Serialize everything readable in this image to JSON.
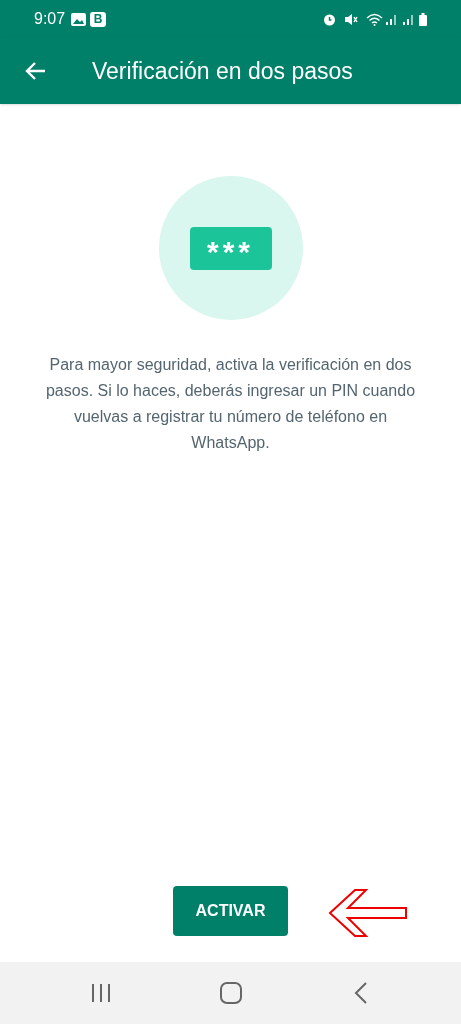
{
  "status_bar": {
    "time": "9:07",
    "app_badge": "B"
  },
  "app_bar": {
    "title": "Verificación en dos pasos"
  },
  "illustration": {
    "pin_mask": "***"
  },
  "description": "Para mayor seguridad, activa la verificación en dos pasos. Si lo haces, deberás ingresar un PIN cuando vuelvas a registrar tu número de teléfono en WhatsApp.",
  "primary_button": {
    "label": "ACTIVAR"
  },
  "nav_bar": {
    "buttons": [
      {
        "kind": "recents"
      },
      {
        "kind": "home"
      },
      {
        "kind": "back"
      }
    ]
  }
}
